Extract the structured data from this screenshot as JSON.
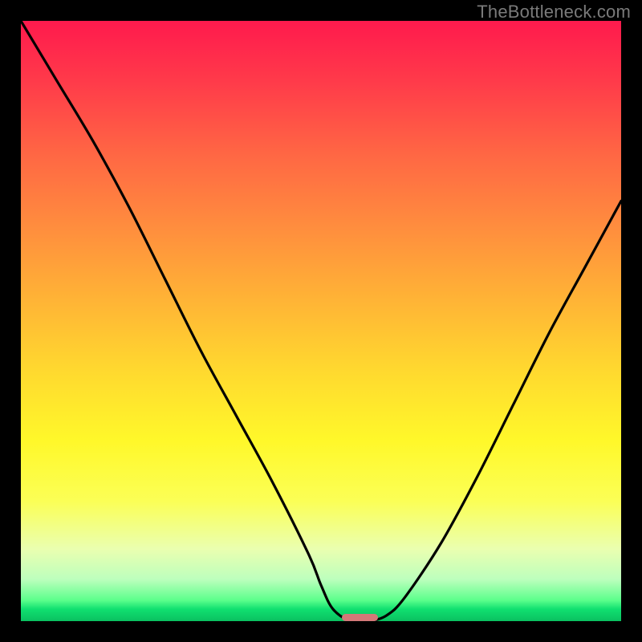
{
  "watermark": "TheBottleneck.com",
  "chart_data": {
    "type": "line",
    "title": "",
    "xlabel": "",
    "ylabel": "",
    "xlim": [
      0,
      100
    ],
    "ylim": [
      0,
      100
    ],
    "series": [
      {
        "name": "curve",
        "x": [
          0,
          6,
          12,
          18,
          24,
          30,
          36,
          42,
          48,
          50,
          52,
          55,
          58,
          61,
          64,
          70,
          76,
          82,
          88,
          94,
          100
        ],
        "values": [
          100,
          90,
          80,
          69,
          57,
          45,
          34,
          23,
          11,
          6,
          2,
          0,
          0,
          1,
          4,
          13,
          24,
          36,
          48,
          59,
          70
        ]
      }
    ],
    "marker": {
      "x": 56.5,
      "y": 0,
      "width_pct": 6,
      "height_pct": 1.2
    },
    "gradient_stops": [
      {
        "pct": 0,
        "color": "#ff1a4d"
      },
      {
        "pct": 10,
        "color": "#ff3a4a"
      },
      {
        "pct": 22,
        "color": "#ff6644"
      },
      {
        "pct": 34,
        "color": "#ff8c3e"
      },
      {
        "pct": 46,
        "color": "#ffb236"
      },
      {
        "pct": 58,
        "color": "#ffd82f"
      },
      {
        "pct": 70,
        "color": "#fff82a"
      },
      {
        "pct": 80,
        "color": "#fbff56"
      },
      {
        "pct": 88,
        "color": "#eaffb0"
      },
      {
        "pct": 93,
        "color": "#bdffbd"
      },
      {
        "pct": 96.5,
        "color": "#5cff8c"
      },
      {
        "pct": 98,
        "color": "#10e070"
      },
      {
        "pct": 100,
        "color": "#0ac060"
      }
    ]
  }
}
